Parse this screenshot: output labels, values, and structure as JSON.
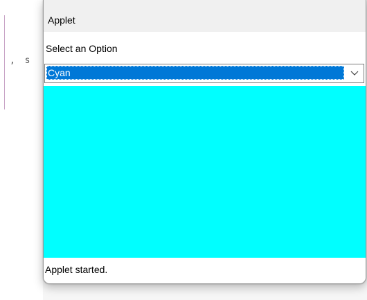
{
  "window": {
    "title": "Applet"
  },
  "panel": {
    "prompt": "Select an Option",
    "choice": {
      "selected": "Cyan"
    },
    "canvas_color": "#00ffff",
    "selection_color": "#0078d7"
  },
  "status": {
    "text": "Applet started."
  },
  "background_editor": {
    "code_fragment": ", s"
  },
  "icons": {
    "dropdown": "chevron-down-icon"
  }
}
